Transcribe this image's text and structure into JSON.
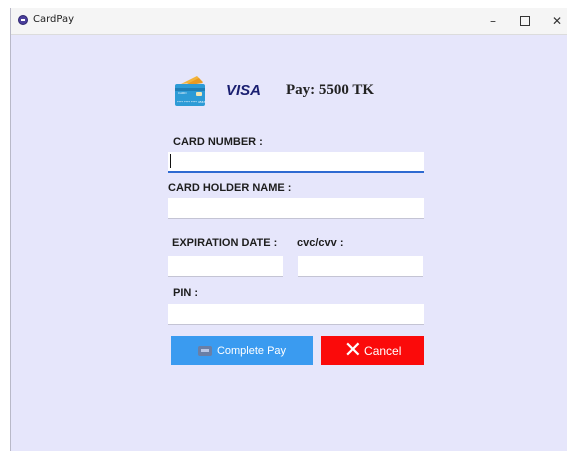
{
  "window": {
    "title": "CardPay",
    "minimize_glyph": "–",
    "maximize_glyph": "",
    "close_glyph": "✕"
  },
  "header": {
    "card_icon": "credit-card-icon",
    "card_icon_text": "CARD",
    "card_icon_number": "**** **** **** 4567",
    "brand": "VISA",
    "amount": "Pay: 5500 TK"
  },
  "form": {
    "card_number": {
      "label": "CARD NUMBER :",
      "value": ""
    },
    "card_holder_name": {
      "label": "CARD HOLDER NAME :",
      "value": ""
    },
    "expiration_date": {
      "label": "EXPIRATION DATE :",
      "value": ""
    },
    "cvc": {
      "label": "cvc/cvv :",
      "value": ""
    },
    "pin": {
      "label": "PIN :",
      "value": ""
    }
  },
  "buttons": {
    "complete_pay": {
      "label": "Complete Pay",
      "icon": "payment-icon",
      "color": "#3a9bf0"
    },
    "cancel": {
      "label": "Cancel",
      "icon": "x-icon",
      "color": "#fb0a0a"
    }
  },
  "colors": {
    "background": "#e6e6fb",
    "focus": "#2f6ad1"
  }
}
